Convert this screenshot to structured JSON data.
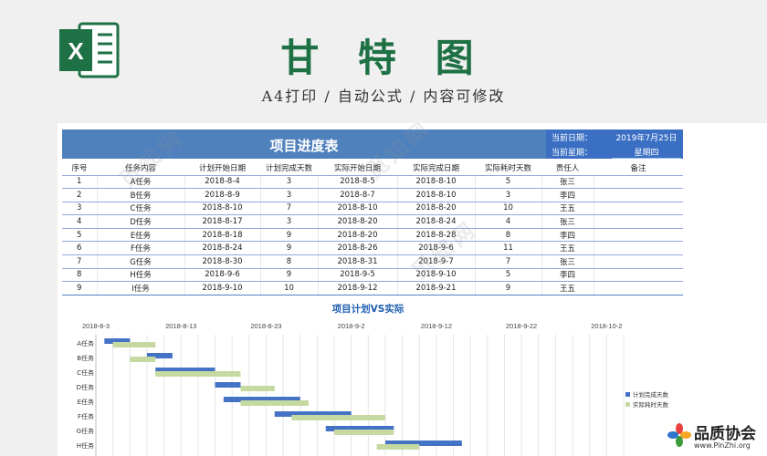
{
  "header": {
    "title": "甘 特 图",
    "subtitle": "A4打印 / 自动公式 / 内容可修改",
    "excel_letter": "X"
  },
  "sheet": {
    "title": "项目进度表",
    "current_date_label": "当前日期：",
    "current_date": "2019年7月25日",
    "current_weekday_label": "当前星期：",
    "current_weekday": "星期四",
    "columns": [
      "序号",
      "任务内容",
      "计划开始日期",
      "计划完成天数",
      "实际开始日期",
      "实际完成日期",
      "实际耗时天数",
      "责任人",
      "备注"
    ],
    "rows": [
      [
        "1",
        "A任务",
        "2018-8-4",
        "3",
        "2018-8-5",
        "2018-8-10",
        "5",
        "张三",
        ""
      ],
      [
        "2",
        "B任务",
        "2018-8-9",
        "3",
        "2018-8-7",
        "2018-8-10",
        "3",
        "李四",
        ""
      ],
      [
        "3",
        "C任务",
        "2018-8-10",
        "7",
        "2018-8-10",
        "2018-8-20",
        "10",
        "王五",
        ""
      ],
      [
        "4",
        "D任务",
        "2018-8-17",
        "3",
        "2018-8-20",
        "2018-8-24",
        "4",
        "张三",
        ""
      ],
      [
        "5",
        "E任务",
        "2018-8-18",
        "9",
        "2018-8-20",
        "2018-8-28",
        "8",
        "李四",
        ""
      ],
      [
        "6",
        "F任务",
        "2018-8-24",
        "9",
        "2018-8-26",
        "2018-9-6",
        "11",
        "王五",
        ""
      ],
      [
        "7",
        "G任务",
        "2018-8-30",
        "8",
        "2018-8-31",
        "2018-9-7",
        "7",
        "张三",
        ""
      ],
      [
        "8",
        "H任务",
        "2018-9-6",
        "9",
        "2018-9-5",
        "2018-9-10",
        "5",
        "李四",
        ""
      ],
      [
        "9",
        "I任务",
        "2018-9-10",
        "10",
        "2018-9-12",
        "2018-9-21",
        "9",
        "王五",
        ""
      ]
    ]
  },
  "chart_data": {
    "type": "bar",
    "orientation": "horizontal-stacked",
    "title": "项目计划VS实际",
    "x_tick_labels": [
      "2018-8-3",
      "2018-8-13",
      "2018-8-23",
      "2018-9-2",
      "2018-9-12",
      "2018-9-22",
      "2018-10-2"
    ],
    "xlim": [
      "2018-8-3",
      "2018-10-4"
    ],
    "categories": [
      "A任务",
      "B任务",
      "C任务",
      "D任务",
      "E任务",
      "F任务",
      "G任务",
      "H任务"
    ],
    "series": [
      {
        "name": "计划完成天数",
        "color": "#4472c4",
        "start": [
          "2018-8-4",
          "2018-8-9",
          "2018-8-10",
          "2018-8-17",
          "2018-8-18",
          "2018-8-24",
          "2018-8-30",
          "2018-9-6"
        ],
        "values": [
          3,
          3,
          7,
          3,
          9,
          9,
          8,
          9
        ]
      },
      {
        "name": "实际耗时天数",
        "color": "#c5d9a0",
        "start": [
          "2018-8-5",
          "2018-8-7",
          "2018-8-10",
          "2018-8-20",
          "2018-8-20",
          "2018-8-26",
          "2018-8-31",
          "2018-9-5"
        ],
        "values": [
          5,
          3,
          10,
          4,
          8,
          11,
          7,
          5
        ]
      }
    ],
    "legend_position": "right",
    "grid": true
  },
  "watermark_text": "觅知网",
  "brand": {
    "name": "品质协会",
    "url": "www.PinZhi.org"
  }
}
